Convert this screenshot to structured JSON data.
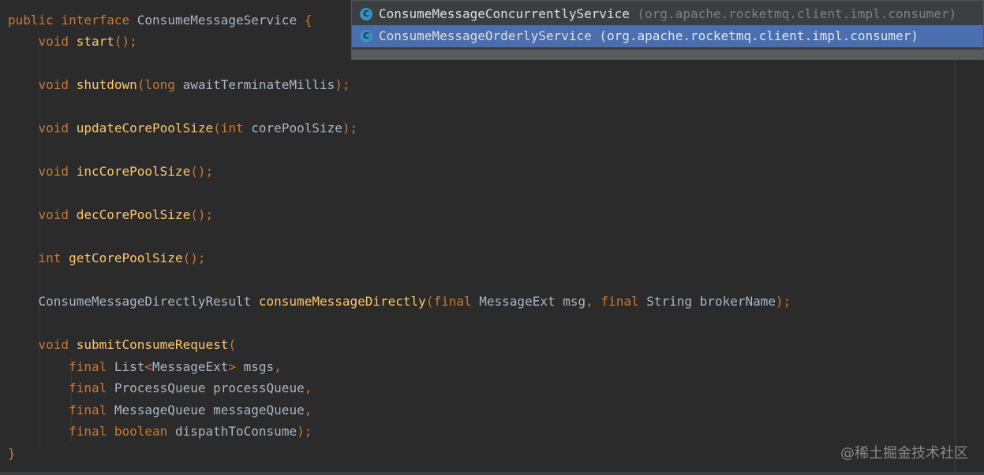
{
  "editor": {
    "line1": {
      "kw1": "public",
      "kw2": "interface",
      "name": "ConsumeMessageService",
      "brace": "{"
    },
    "start": {
      "ret": "void",
      "name": "start",
      "rest": "();"
    },
    "shutdown": {
      "ret": "void",
      "name": "shutdown",
      "open": "(",
      "ptype": "long",
      "pname": "awaitTerminateMillis",
      "close": ");"
    },
    "update": {
      "ret": "void",
      "name": "updateCorePoolSize",
      "open": "(",
      "ptype": "int",
      "pname": "corePoolSize",
      "close": ");"
    },
    "inc": {
      "ret": "void",
      "name": "incCorePoolSize",
      "rest": "();"
    },
    "dec": {
      "ret": "void",
      "name": "decCorePoolSize",
      "rest": "();"
    },
    "get": {
      "ret": "int",
      "name": "getCorePoolSize",
      "rest": "();"
    },
    "direct": {
      "ret": "ConsumeMessageDirectlyResult",
      "name": "consumeMessageDirectly",
      "open": "(",
      "final1": "final",
      "type1": "MessageExt",
      "param1": "msg",
      "comma": ",",
      "final2": "final",
      "type2": "String",
      "param2": "brokerName",
      "close": ");"
    },
    "submit": {
      "ret": "void",
      "name": "submitConsumeRequest",
      "open": "("
    },
    "p1": {
      "final": "final",
      "type": "List",
      "lt": "<",
      "generic": "MessageExt",
      "gt": ">",
      "name": "msgs",
      "end": ","
    },
    "p2": {
      "final": "final",
      "type": "ProcessQueue",
      "name": "processQueue",
      "end": ","
    },
    "p3": {
      "final": "final",
      "type": "MessageQueue",
      "name": "messageQueue",
      "end": ","
    },
    "p4": {
      "final": "final",
      "type": "boolean",
      "name": "dispathToConsume",
      "end": ");"
    },
    "close_brace": "}"
  },
  "popup": {
    "items": [
      {
        "icon": "C",
        "name": "ConsumeMessageConcurrentlyService",
        "package": "(org.apache.rocketmq.client.impl.consumer)"
      },
      {
        "icon": "C",
        "name": "ConsumeMessageOrderlyService",
        "package": "(org.apache.rocketmq.client.impl.consumer)"
      }
    ],
    "selected_index": 1
  },
  "watermark": "@稀土掘金技术社区",
  "colors": {
    "background": "#2b2b2b",
    "keyword": "#cc7832",
    "method": "#ffc66d",
    "identifier": "#a9b7c6",
    "popup_bg": "#3c3f41",
    "popup_selected": "#4b6eaf",
    "class_icon": "#3592c4"
  }
}
